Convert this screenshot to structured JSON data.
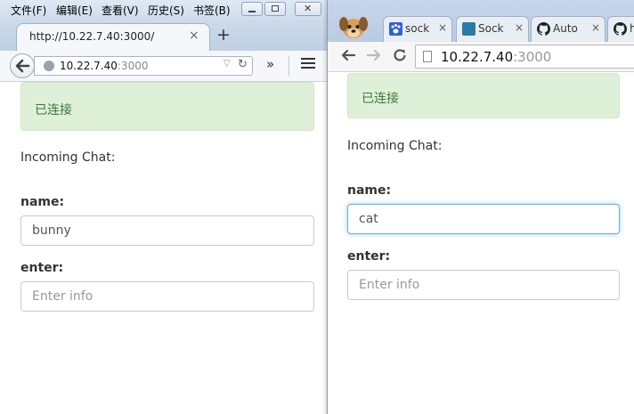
{
  "firefox": {
    "menus": [
      "文件(F)",
      "编辑(E)",
      "查看(V)",
      "历史(S)",
      "书签(B)"
    ],
    "tab_title": "http://10.22.7.40:3000/",
    "tab_close": "×",
    "new_tab": "+",
    "url_host": "10.22.7.40",
    "url_port": ":3000",
    "overflow": "»"
  },
  "chrome": {
    "tabs": [
      {
        "title": "sock",
        "favicon": "paw-icon",
        "color": "#2f63d6"
      },
      {
        "title": "Sock",
        "favicon": "square-icon",
        "color": "#2a7aa8"
      },
      {
        "title": "Auto",
        "favicon": "github-icon",
        "color": "#222222"
      },
      {
        "title": "h",
        "favicon": "github-icon",
        "color": "#222222"
      }
    ],
    "tab_close": "×",
    "url_host": "10.22.7.40",
    "url_port": ":3000"
  },
  "left_page": {
    "status": "已连接",
    "incoming": "Incoming Chat:",
    "name_label": "name:",
    "name_value": "bunny",
    "enter_label": "enter:",
    "enter_placeholder": "Enter info"
  },
  "right_page": {
    "status": "已连接",
    "incoming": "Incoming Chat:",
    "name_label": "name:",
    "name_value": "cat",
    "enter_label": "enter:",
    "enter_placeholder": "Enter info"
  },
  "colors": {
    "alert_bg": "#dff0d8",
    "alert_text": "#3c763d",
    "focus_border": "#66afe9"
  }
}
